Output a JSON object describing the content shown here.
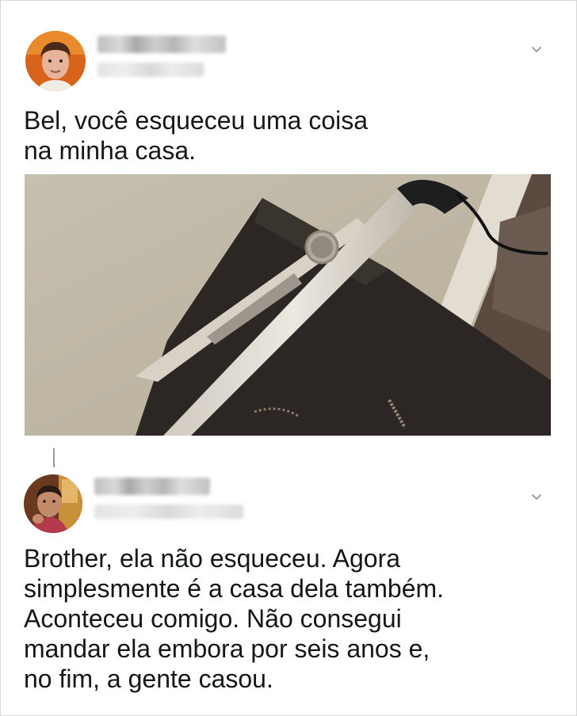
{
  "tweet1": {
    "text": "Bel, você esqueceu uma coisa\nna minha casa.",
    "avatar_icon": "profile-photo",
    "menu_icon": "chevron-down-icon",
    "media": "photo of a hair straightener left on a dresser"
  },
  "tweet2": {
    "text": "Brother, ela não esqueceu. Agora\nsimplesmente é a casa dela também.\nAconteceu comigo. Não consegui\nmandar ela embora por seis anos e,\nno fim, a gente casou.",
    "avatar_icon": "profile-photo",
    "menu_icon": "chevron-down-icon"
  },
  "colors": {
    "text": "#14171a",
    "chevron": "#8899a6",
    "border": "#d6d6d6"
  }
}
